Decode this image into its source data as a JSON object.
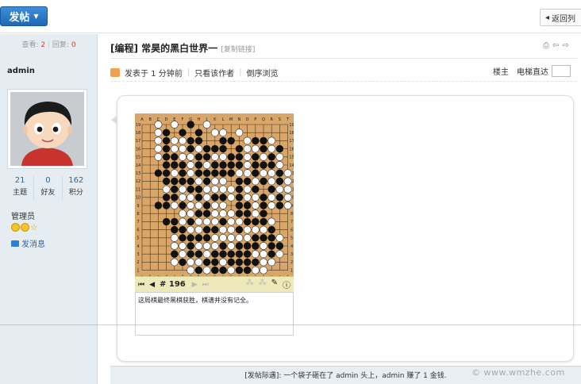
{
  "topbar": {
    "post_label": "发帖",
    "back_label": "返回列"
  },
  "left": {
    "views_label": "查看:",
    "views": "2",
    "replies_label": "回复:",
    "replies": "0",
    "author": "admin",
    "stats": [
      {
        "value": "21",
        "label": "主题"
      },
      {
        "value": "0",
        "label": "好友"
      },
      {
        "value": "162",
        "label": "积分"
      }
    ],
    "role": "管理员",
    "message_label": "发消息"
  },
  "post": {
    "title": "[编程] 常昊的黑白世界一",
    "copy_link": "[复制链接]",
    "posted": "发表于 1 分钟前",
    "only_author": "只看该作者",
    "reverse": "倒序浏览",
    "floor": "楼主",
    "jump_label": "电梯直达"
  },
  "game": {
    "columns": [
      "A",
      "B",
      "C",
      "D",
      "E",
      "F",
      "G",
      "H",
      "J",
      "K",
      "L",
      "M",
      "N",
      "O",
      "P",
      "Q",
      "R",
      "S",
      "T"
    ],
    "columns_bottom": [
      "a",
      "b",
      "c",
      "d",
      "e",
      "f",
      "g",
      "h",
      "j",
      "k",
      "l",
      "m",
      "n",
      "o",
      "p",
      "q",
      "r",
      "s",
      "t"
    ],
    "rows": [
      "19",
      "18",
      "17",
      "16",
      "15",
      "14",
      "13",
      "12",
      "11",
      "10",
      "9",
      "8",
      "7",
      "6",
      "5",
      "4",
      "3",
      "2",
      "1"
    ],
    "move_label": "# 196",
    "comment": "这局棋最终黑棋获胜，棋谱并没有记全。",
    "stones": {
      "black": [
        "G19",
        "H18",
        "F18",
        "D18",
        "D17",
        "G17",
        "H17",
        "L17",
        "M17",
        "P17",
        "Q17",
        "D16",
        "G16",
        "J16",
        "K16",
        "L16",
        "N16",
        "S16",
        "Q16",
        "D15",
        "E15",
        "H15",
        "J15",
        "M15",
        "N15",
        "P15",
        "R15",
        "D14",
        "E14",
        "F14",
        "H14",
        "K14",
        "L14",
        "M14",
        "N14",
        "P14",
        "Q14",
        "R14",
        "C13",
        "D13",
        "F13",
        "H13",
        "J13",
        "K13",
        "L13",
        "M13",
        "P13",
        "S13",
        "D12",
        "E12",
        "F12",
        "G12",
        "J12",
        "N12",
        "O12",
        "Q12",
        "S12",
        "E11",
        "G11",
        "H11",
        "N11",
        "P11",
        "R11",
        "D10",
        "E10",
        "H10",
        "K10",
        "L10",
        "N10",
        "Q10",
        "S10",
        "C9",
        "D9",
        "F9",
        "J9",
        "N9",
        "O9",
        "Q9",
        "S9",
        "H8",
        "J8",
        "N8",
        "O8",
        "Q8",
        "D7",
        "E7",
        "G7",
        "L7",
        "O7",
        "P7",
        "Q7",
        "E6",
        "F6",
        "J6",
        "K6",
        "N6",
        "R6",
        "F5",
        "G5",
        "H5",
        "J5",
        "P5",
        "Q5",
        "R5",
        "G4",
        "L4",
        "N4",
        "O4",
        "P4",
        "R4",
        "S4",
        "E3",
        "G3",
        "H3",
        "K3",
        "L3",
        "M3",
        "N3",
        "O3",
        "R3",
        "F2",
        "J2",
        "K2",
        "M2",
        "N2",
        "O2",
        "P2",
        "H1",
        "K1",
        "L1",
        "N1",
        "O1"
      ],
      "white": [
        "C19",
        "E19",
        "K18",
        "L18",
        "N18",
        "C18",
        "J19",
        "C17",
        "E17",
        "F17",
        "H17",
        "O17",
        "R17",
        "C16",
        "E16",
        "F16",
        "H16",
        "O16",
        "P16",
        "R16",
        "Q15",
        "C15",
        "F15",
        "G15",
        "K15",
        "L15",
        "O15",
        "S15",
        "G14",
        "J14",
        "O14",
        "S14",
        "T13",
        "E13",
        "G13",
        "N13",
        "O13",
        "Q13",
        "R13",
        "T12",
        "G12",
        "H12",
        "K12",
        "L12",
        "P12",
        "R12",
        "T11",
        "D11",
        "F11",
        "J11",
        "K11",
        "L11",
        "M11",
        "O11",
        "S11",
        "T10",
        "F10",
        "G10",
        "J10",
        "M10",
        "O10",
        "P10",
        "R10",
        "E9",
        "G9",
        "H9",
        "K9",
        "L9",
        "P9",
        "R9",
        "T9",
        "F8",
        "G8",
        "K8",
        "L8",
        "M8",
        "P8",
        "F7",
        "H7",
        "J7",
        "K7",
        "M7",
        "N7",
        "R7",
        "G6",
        "H6",
        "L6",
        "M6",
        "O6",
        "P6",
        "Q6",
        "E5",
        "K5",
        "L5",
        "M5",
        "N5",
        "O5",
        "S5",
        "E4",
        "F4",
        "H4",
        "J4",
        "K4",
        "M4",
        "Q4",
        "F3",
        "J3",
        "P3",
        "Q3",
        "S3",
        "E2",
        "G2",
        "H2",
        "L2",
        "Q2",
        "R2",
        "G1",
        "J1",
        "M1",
        "P1",
        "Q1"
      ]
    }
  },
  "footer": {
    "text": "[发帖际遇]: 一个袋子砸在了 admin 头上，admin 赚了 1 金钱.",
    "watermark": "© www.wmzhe.com"
  }
}
